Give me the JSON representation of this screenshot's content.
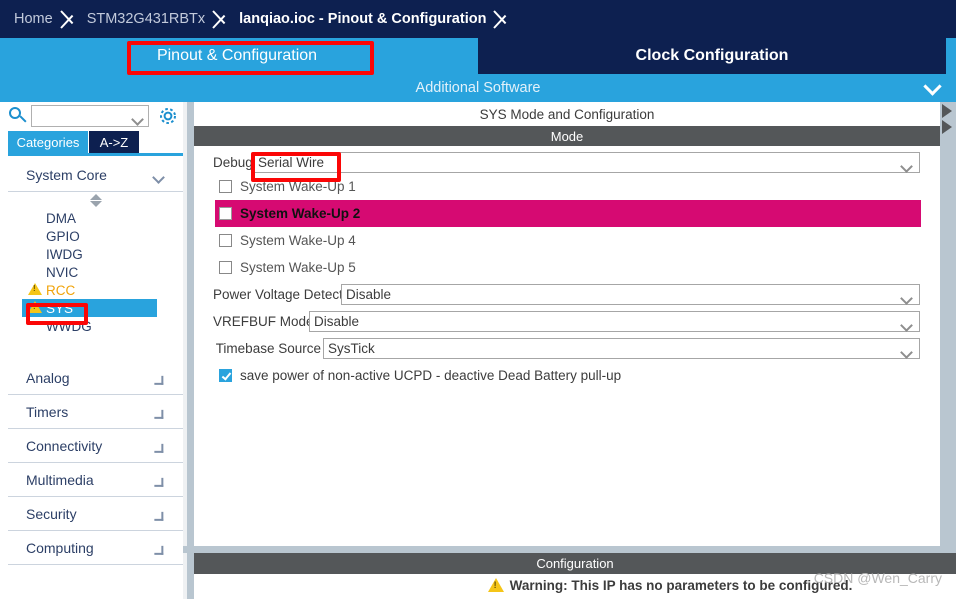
{
  "breadcrumb": {
    "items": [
      {
        "label": "Home",
        "state": "dim"
      },
      {
        "label": "STM32G431RBTx",
        "state": "dim"
      },
      {
        "label": "lanqiao.ioc - Pinout & Configuration",
        "state": "active"
      }
    ]
  },
  "tabs": {
    "pinout": "Pinout & Configuration",
    "clock": "Clock Configuration",
    "additional_software": "Additional Software"
  },
  "sidebar": {
    "search": {
      "value": "",
      "placeholder": ""
    },
    "gear_tooltip": "Settings",
    "view_tabs": [
      {
        "label": "Categories",
        "active": true
      },
      {
        "label": "A->Z",
        "active": false
      }
    ],
    "groups": [
      {
        "label": "System Core",
        "expanded": true,
        "items": [
          {
            "label": "DMA",
            "warning": false,
            "selected": false
          },
          {
            "label": "GPIO",
            "warning": false,
            "selected": false
          },
          {
            "label": "IWDG",
            "warning": false,
            "selected": false
          },
          {
            "label": "NVIC",
            "warning": false,
            "selected": false
          },
          {
            "label": "RCC",
            "warning": true,
            "selected": false
          },
          {
            "label": "SYS",
            "warning": true,
            "selected": true
          },
          {
            "label": "WWDG",
            "warning": false,
            "selected": false
          }
        ]
      },
      {
        "label": "Analog",
        "expanded": false,
        "items": []
      },
      {
        "label": "Timers",
        "expanded": false,
        "items": []
      },
      {
        "label": "Connectivity",
        "expanded": false,
        "items": []
      },
      {
        "label": "Multimedia",
        "expanded": false,
        "items": []
      },
      {
        "label": "Security",
        "expanded": false,
        "items": []
      },
      {
        "label": "Computing",
        "expanded": false,
        "items": []
      }
    ]
  },
  "main": {
    "panel_title": "SYS Mode and Configuration",
    "mode_section": "Mode",
    "debug": {
      "label": "Debug",
      "value": "Serial Wire"
    },
    "wakeups": [
      {
        "label": "System Wake-Up 1",
        "checked": false,
        "highlight": false
      },
      {
        "label": "System Wake-Up 2",
        "checked": false,
        "highlight": true
      },
      {
        "label": "System Wake-Up 4",
        "checked": false,
        "highlight": false
      },
      {
        "label": "System Wake-Up 5",
        "checked": false,
        "highlight": false
      }
    ],
    "pvd": {
      "label": "Power Voltage Detector In",
      "value": "Disable"
    },
    "vrefbuf": {
      "label": "VREFBUF Mode",
      "value": "Disable"
    },
    "timebase": {
      "label": "Timebase Source",
      "value": "SysTick"
    },
    "ucpd": {
      "label": "save power of non-active UCPD - deactive Dead Battery pull-up",
      "checked": true
    },
    "config_section": "Configuration",
    "warning": "Warning: This IP has no parameters to be configured."
  },
  "watermark": "CSDN @Wen_Carry",
  "colors": {
    "breadcrumb_bg": "#0d2050",
    "tab_active_bg": "#29a3dd",
    "tab_inactive_bg": "#0d2050",
    "accent_blue": "#29a3dd",
    "section_bar": "#545759",
    "highlight_magenta": "#d60a72",
    "warning_yellow": "#f5c518",
    "annotation_red": "#fb0606",
    "gutter_gray": "#b9c6d0"
  }
}
